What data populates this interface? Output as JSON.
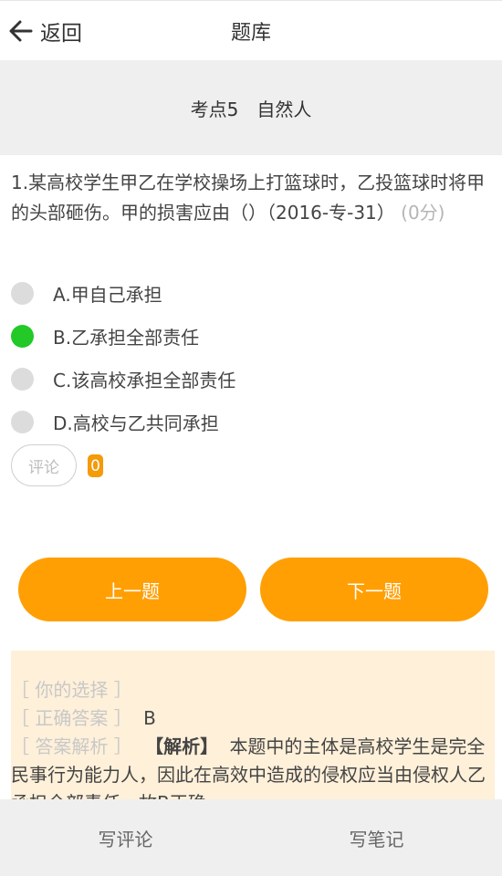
{
  "header": {
    "back_label": "返回",
    "title": "题库",
    "back_icon": "arrow-left-icon"
  },
  "section": {
    "title": "考点5　自然人"
  },
  "question": {
    "text": "1.某高校学生甲乙在学校操场上打篮球时，乙投篮球时将甲的头部砸伤。甲的损害应由（）（2016-专-31）",
    "score": "(0分)"
  },
  "options": [
    {
      "label": "A.甲自己承担",
      "selected": false
    },
    {
      "label": "B.乙承担全部责任",
      "selected": true
    },
    {
      "label": "C.该高校承担全部责任",
      "selected": false
    },
    {
      "label": "D.高校与乙共同承担",
      "selected": false
    }
  ],
  "comments": {
    "button_label": "评论",
    "count": "0"
  },
  "navigation": {
    "prev_label": "上一题",
    "next_label": "下一题"
  },
  "analysis": {
    "your_choice_label": "［ 你的选择 ］",
    "your_choice_value": "",
    "correct_answer_label": "［ 正确答案 ］",
    "correct_answer_value": "B",
    "explanation_label": "［ 答案解析 ］",
    "explanation_prefix": "【解析】",
    "explanation_text": "本题中的主体是高校学生是完全民事行为能力人，因此在高效中造成的侵权应当由侵权人乙承担全部责任，故B正确。"
  },
  "footer": {
    "write_comment": "写评论",
    "write_note": "写笔记"
  },
  "colors": {
    "accent": "#ff9f03",
    "selected": "#22c927",
    "analysis_bg": "#fff0d9"
  }
}
